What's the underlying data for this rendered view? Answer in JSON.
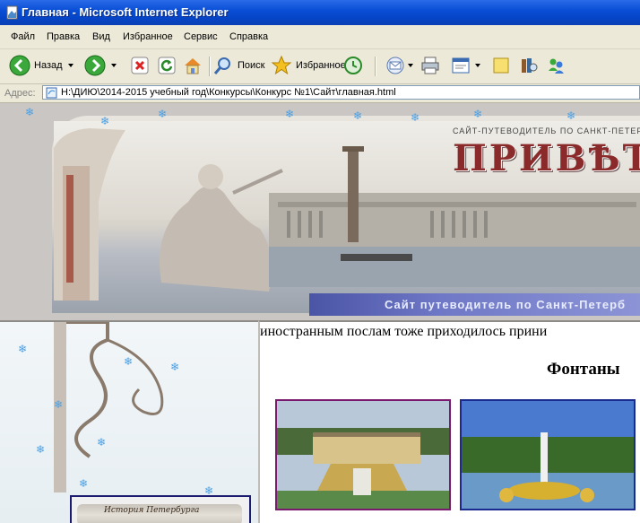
{
  "window": {
    "title": "Главная - Microsoft Internet Explorer"
  },
  "menu": {
    "items": [
      "Файл",
      "Правка",
      "Вид",
      "Избранное",
      "Сервис",
      "Справка"
    ]
  },
  "toolbar": {
    "back_label": "Назад",
    "search_label": "Поиск",
    "favorites_label": "Избранное"
  },
  "address": {
    "label": "Адрес:",
    "value": "H:\\ДИЮ\\2014-2015 учебный год\\Конкурсы\\Конкурс №1\\Сайт\\главная.html"
  },
  "banner": {
    "subtitle_top": "САЙТ-ПУТЕВОДИТЕЛЬ ПО САНКТ-ПЕТЕРБ",
    "logo": "ПРИВѢТЪ",
    "strip": "Сайт путеводитель по Санкт-Петерб"
  },
  "sidebar": {
    "box_label": "История Петербурга"
  },
  "content": {
    "text1": "иностранным послам тоже приходилось прини",
    "heading": "Фонтаны"
  },
  "colors": {
    "titlebar": "#0a4fd6",
    "strip": "#5a64b6",
    "photo1_border": "#7a1a6e",
    "photo2_border": "#1a2a8e"
  }
}
